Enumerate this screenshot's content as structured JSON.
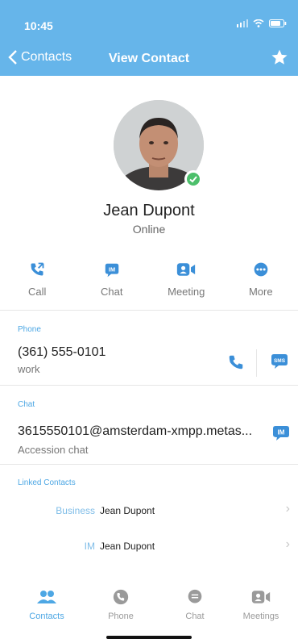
{
  "status_bar": {
    "time": "10:45"
  },
  "nav": {
    "back_label": "Contacts",
    "title": "View Contact"
  },
  "profile": {
    "name": "Jean Dupont",
    "status": "Online"
  },
  "actions": [
    {
      "label": "Call",
      "icon": "call-icon"
    },
    {
      "label": "Chat",
      "icon": "im-icon"
    },
    {
      "label": "Meeting",
      "icon": "meeting-icon"
    },
    {
      "label": "More",
      "icon": "more-icon"
    }
  ],
  "phone_section": {
    "label": "Phone",
    "number": "(361) 555-0101",
    "type": "work",
    "sms_badge": "SMS"
  },
  "chat_section": {
    "label": "Chat",
    "address": "3615550101@amsterdam-xmpp.metas...",
    "type": "Accession chat",
    "im_badge": "IM"
  },
  "linked_section": {
    "label": "Linked Contacts",
    "items": [
      {
        "type": "Business",
        "name": "Jean Dupont"
      },
      {
        "type": "IM",
        "name": "Jean Dupont"
      }
    ]
  },
  "tabbar": {
    "tabs": [
      {
        "label": "Contacts",
        "active": true
      },
      {
        "label": "Phone",
        "active": false
      },
      {
        "label": "Chat",
        "active": false
      },
      {
        "label": "Meetings",
        "active": false
      }
    ]
  },
  "colors": {
    "header": "#66b5ea",
    "accent": "#4da7e4",
    "presence": "#4cbf6b"
  }
}
